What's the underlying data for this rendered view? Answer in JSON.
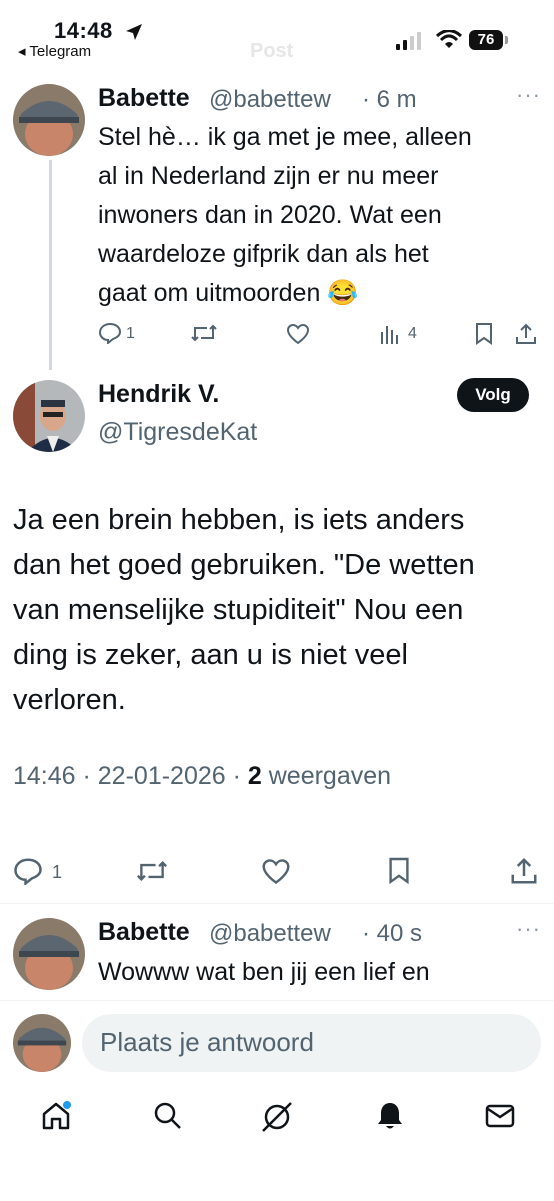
{
  "status_bar": {
    "time": "14:48",
    "back_app": "◂ Telegram",
    "battery": "76",
    "ghost_title": "Post"
  },
  "tweets": [
    {
      "name": "Babette",
      "handle": "@babettew",
      "time": "· 6 m",
      "text_lines": [
        "Stel hè… ik ga met je mee, alleen",
        "al in Nederland zijn er nu meer",
        "inwoners dan in 2020. Wat een",
        "waardeloze gifprik dan als het",
        "gaat om uitmoorden 😂"
      ],
      "replies": "1",
      "views": "4"
    }
  ],
  "main_post": {
    "name": "Hendrik V.",
    "handle": "@TigresdeKat",
    "follow_label": "Volg",
    "text_lines": [
      "Ja een brein hebben, is iets anders",
      "dan het goed gebruiken. \"De wetten",
      "van menselijke stupiditeit\" Nou een",
      "ding is zeker, aan u is niet veel",
      "verloren."
    ],
    "timestamp": "14:46 · 22-01-2026 · ",
    "views_count": "2",
    "views_label": " weergaven",
    "replies": "1"
  },
  "reply_tweet": {
    "name": "Babette",
    "handle": "@babettew",
    "time": "· 40 s",
    "text": "Wowww wat ben jij een lief en"
  },
  "composer": {
    "placeholder": "Plaats je antwoord"
  },
  "nav": [
    "home-icon",
    "search-icon",
    "grok-icon",
    "notifications-icon",
    "messages-icon"
  ]
}
